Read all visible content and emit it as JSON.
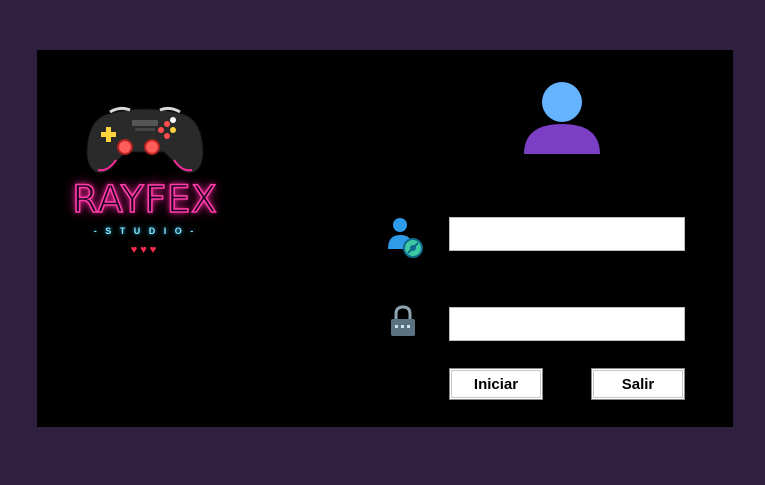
{
  "brand": {
    "name": "RAYFEX",
    "tagline": "- S T U D I O -",
    "hearts": "♥♥♥"
  },
  "form": {
    "username_value": "",
    "password_value": ""
  },
  "buttons": {
    "login_label": "Iniciar",
    "exit_label": "Salir"
  },
  "icons": {
    "avatar": "user-avatar-icon",
    "username": "user-gear-icon",
    "password": "lock-icon",
    "logo": "gamepad-icon"
  },
  "colors": {
    "frame": "#2f2040",
    "panel": "#000000",
    "accent_pink": "#ff3ca6",
    "accent_cyan": "#7fe7ff",
    "avatar_head": "#66b3ff",
    "avatar_body": "#7a3fc4"
  }
}
